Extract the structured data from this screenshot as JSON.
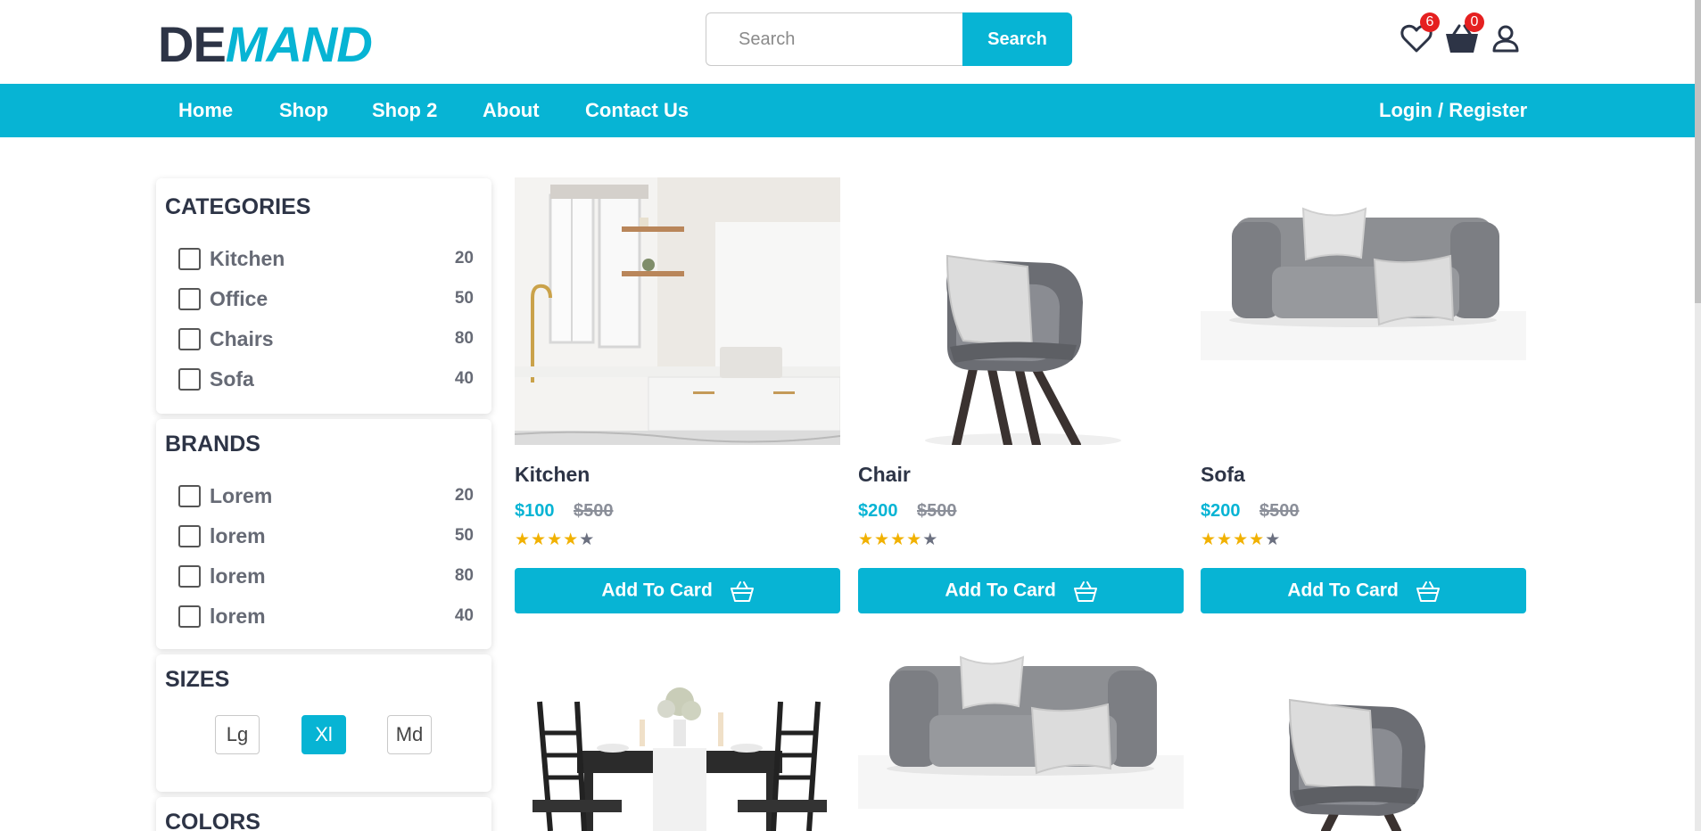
{
  "brand": {
    "part1": "DE",
    "part2": "MAND"
  },
  "search": {
    "placeholder": "Search",
    "button": "Search"
  },
  "header_icons": {
    "wishlist_count": "6",
    "cart_count": "0"
  },
  "nav": {
    "items": [
      "Home",
      "Shop",
      "Shop 2",
      "About",
      "Contact Us"
    ],
    "login": "Login / Register"
  },
  "categories": {
    "title": "CATEGORIES",
    "items": [
      {
        "label": "Kitchen",
        "count": "20"
      },
      {
        "label": "Office",
        "count": "50"
      },
      {
        "label": "Chairs",
        "count": "80"
      },
      {
        "label": "Sofa",
        "count": "40"
      }
    ]
  },
  "brands": {
    "title": "BRANDS",
    "items": [
      {
        "label": "Lorem",
        "count": "20"
      },
      {
        "label": "lorem",
        "count": "50"
      },
      {
        "label": "lorem",
        "count": "80"
      },
      {
        "label": "lorem",
        "count": "40"
      }
    ]
  },
  "sizes": {
    "title": "SIZES",
    "options": [
      "Lg",
      "Xl",
      "Md"
    ],
    "selected": "Xl"
  },
  "colors": {
    "title": "COLORS"
  },
  "products": [
    {
      "title": "Kitchen",
      "price": "$100",
      "old_price": "$500",
      "rating": 4,
      "button": "Add To Card",
      "image": "kitchen-photo"
    },
    {
      "title": "Chair",
      "price": "$200",
      "old_price": "$500",
      "rating": 4,
      "button": "Add To Card",
      "image": "chair-photo"
    },
    {
      "title": "Sofa",
      "price": "$200",
      "old_price": "$500",
      "rating": 4,
      "button": "Add To Card",
      "image": "sofa-photo"
    },
    {
      "image": "dining-table-photo"
    },
    {
      "image": "sofa-photo"
    },
    {
      "image": "chair-photo"
    }
  ],
  "colors_theme": {
    "accent": "#07b4d4",
    "dark": "#2d3446",
    "badge": "#e52020",
    "star": "#f1b100"
  }
}
